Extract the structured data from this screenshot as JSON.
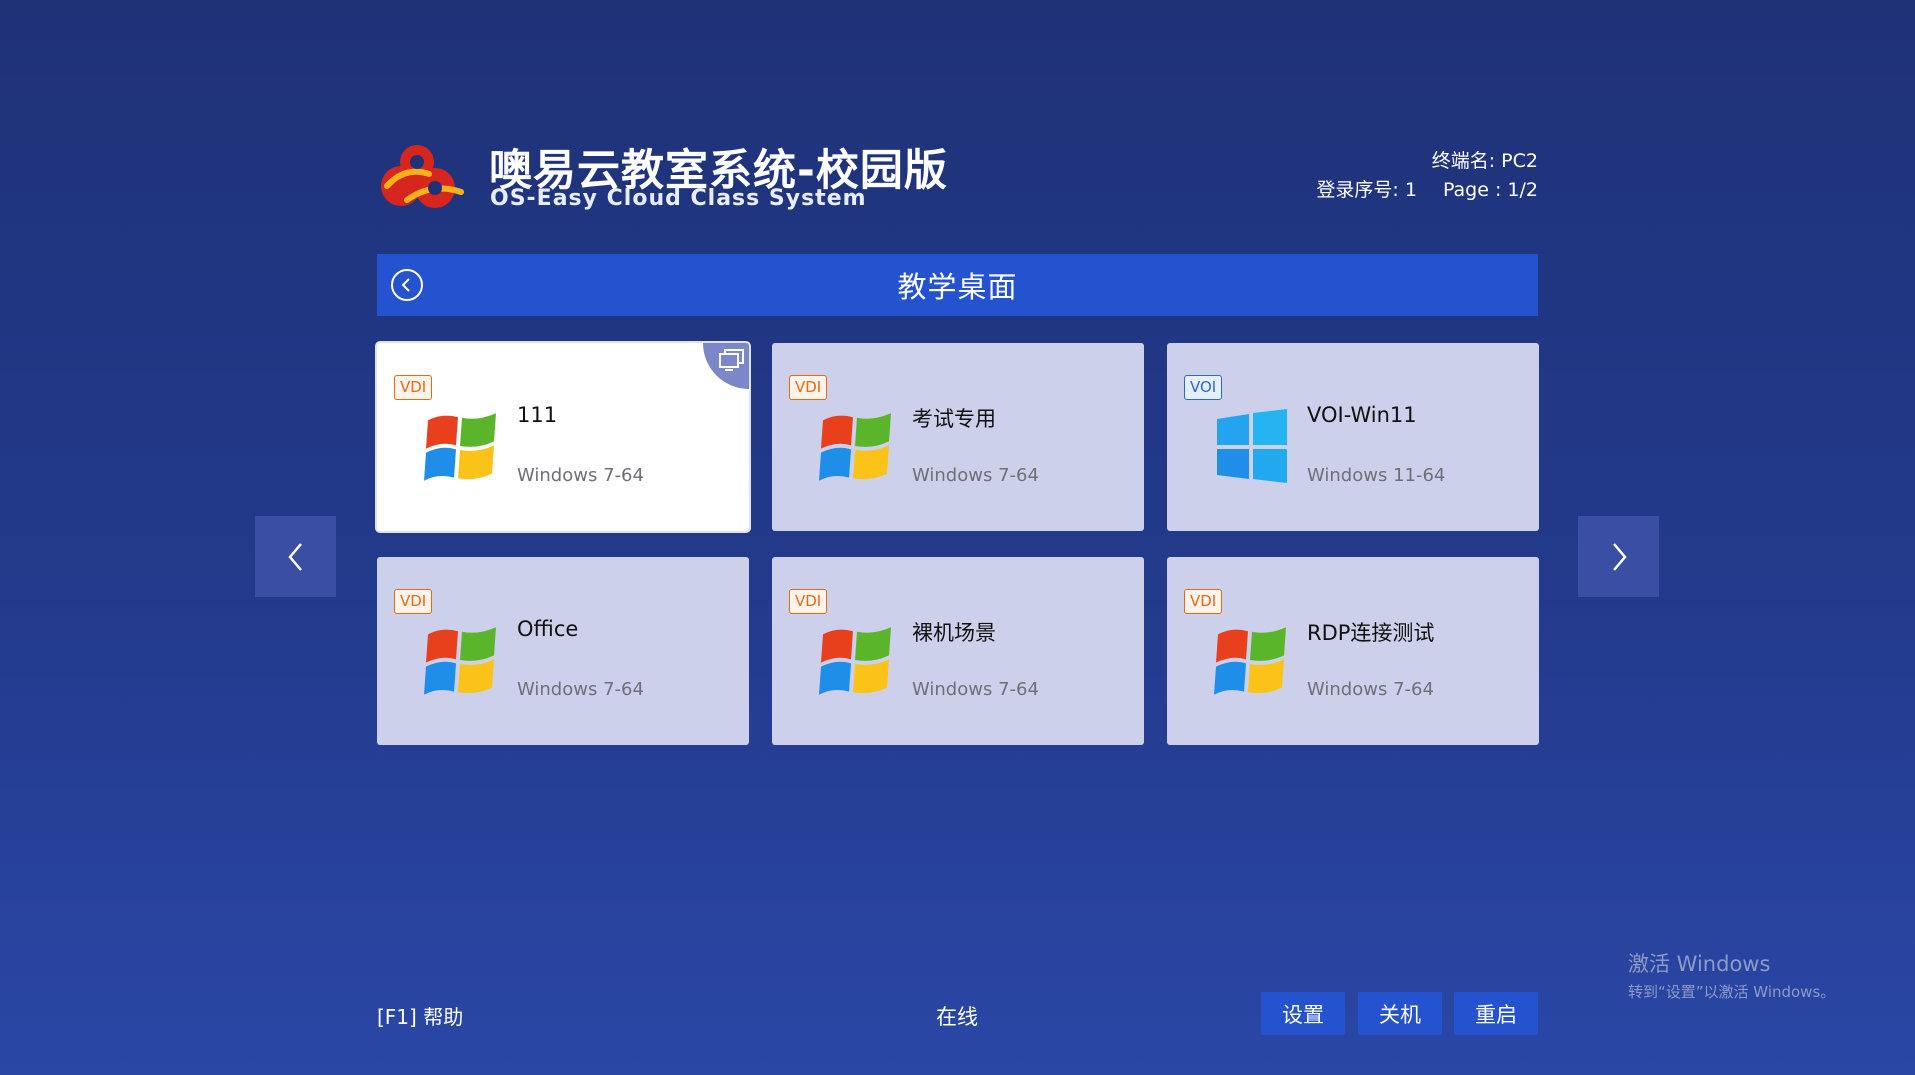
{
  "header": {
    "title": "噢易云教室系统-校园版",
    "subtitle": "OS-Easy Cloud Class System",
    "terminal_label": "终端名: PC2",
    "login_label": "登录序号: 1",
    "page_label": "Page : 1/2"
  },
  "title_bar": {
    "title": "教学桌面"
  },
  "cards": [
    {
      "badge": "VDI",
      "name": "111",
      "os": "Windows 7-64",
      "selected": true
    },
    {
      "badge": "VDI",
      "name": "考试专用",
      "os": "Windows 7-64"
    },
    {
      "badge": "VOI",
      "name": "VOI-Win11",
      "os": "Windows 11-64"
    },
    {
      "badge": "VDI",
      "name": "Office",
      "os": "Windows 7-64"
    },
    {
      "badge": "VDI",
      "name": "裸机场景",
      "os": "Windows 7-64"
    },
    {
      "badge": "VDI",
      "name": "RDP连接测试",
      "os": "Windows 7-64"
    }
  ],
  "footer": {
    "help": "[F1] 帮助",
    "status": "在线",
    "settings": "设置",
    "shutdown": "关机",
    "restart": "重启"
  },
  "watermark": {
    "line1": "激活 Windows",
    "line2": "转到“设置”以激活 Windows。"
  },
  "colors": {
    "background": "#233a8c",
    "accent": "#2552cf",
    "card": "#cdd0ea",
    "vdi_badge": "#e56a16",
    "voi_badge": "#2a68d8"
  },
  "icons": {
    "back": "circle-chevron-left-icon",
    "prev": "chevron-left-icon",
    "next": "chevron-right-icon",
    "win7": "windows-7-logo-icon",
    "win11": "windows-11-logo-icon",
    "desktop": "desktop-icon"
  }
}
